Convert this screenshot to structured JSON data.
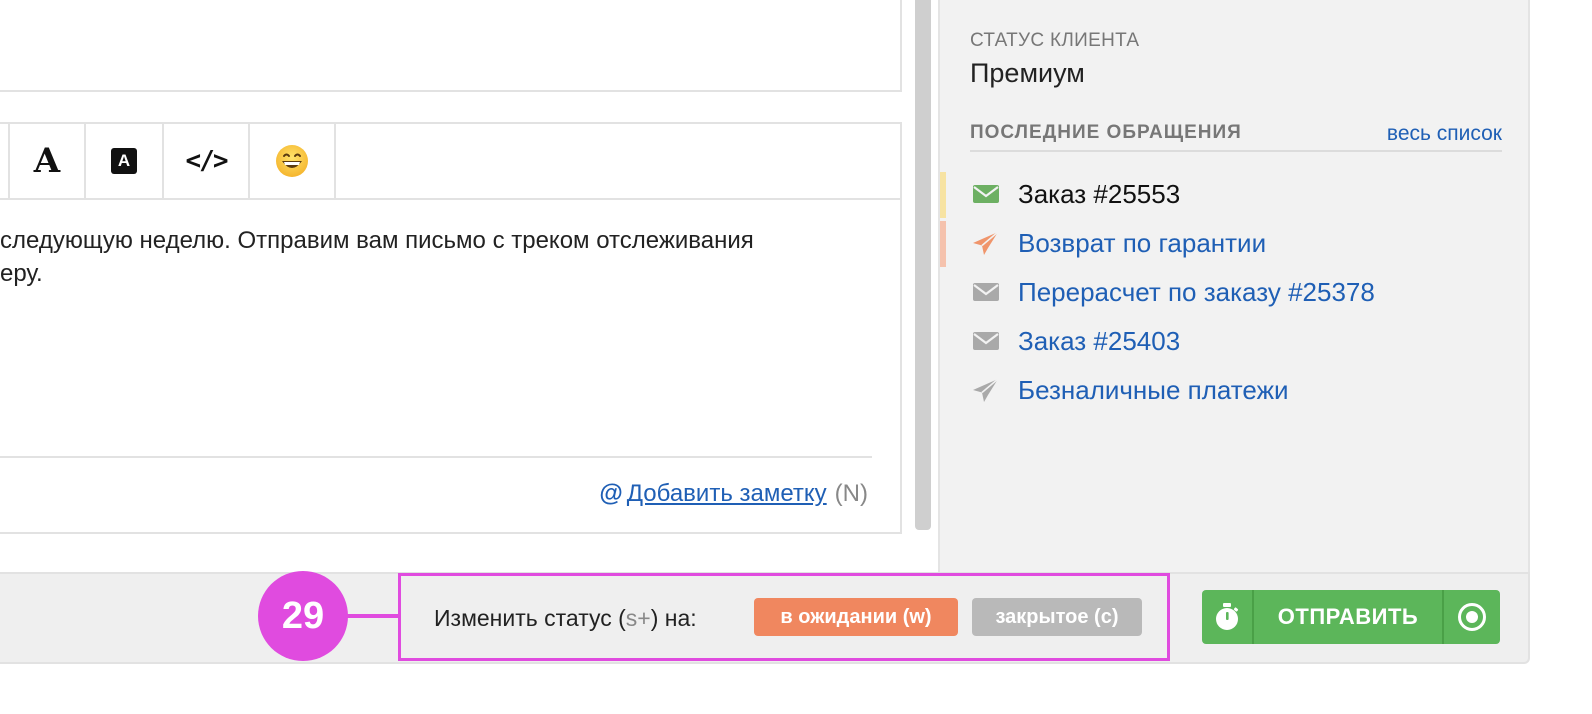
{
  "editor": {
    "toolbar": {
      "font_button_glyph": "A",
      "highlight_button_glyph": "A",
      "code_button_glyph": "</>",
      "emoji_button_glyph": "😄"
    },
    "body_lines": [
      "следующую неделю. Отправим вам письмо с треком отслеживания",
      "еру."
    ],
    "add_note": {
      "at_symbol": "@",
      "link_label": "Добавить заметку",
      "shortcut": "(N)"
    }
  },
  "sidebar": {
    "customer_status_label": "СТАТУС КЛИЕНТА",
    "customer_status_value": "Премиум",
    "recent_requests": {
      "title": "ПОСЛЕДНИЕ ОБРАЩЕНИЯ",
      "all_link": "весь список",
      "items": [
        {
          "label": "Заказ #25553",
          "icon": "envelope-icon",
          "icon_color": "#6db063",
          "marker_color": "#f7e3a2",
          "is_link": false
        },
        {
          "label": "Возврат по гарантии",
          "icon": "paper-plane-icon",
          "icon_color": "#f0956b",
          "marker_color": "#f5c2ad",
          "is_link": true
        },
        {
          "label": "Перерасчет по заказу #25378",
          "icon": "envelope-icon",
          "icon_color": "#a9a9a9",
          "marker_color": "",
          "is_link": true
        },
        {
          "label": "Заказ #25403",
          "icon": "envelope-icon",
          "icon_color": "#a9a9a9",
          "marker_color": "",
          "is_link": true
        },
        {
          "label": "Безналичные платежи",
          "icon": "paper-plane-icon",
          "icon_color": "#a9a9a9",
          "marker_color": "",
          "is_link": true
        }
      ]
    }
  },
  "bottom_bar": {
    "callout_number": "29",
    "status_change": {
      "label_prefix": "Изменить статус (",
      "shortcut_hint": "s+",
      "label_suffix": ") на:",
      "pending_label": "в ожидании (w)",
      "closed_label": "закрытое (c)"
    },
    "send_button_label": "ОТПРАВИТЬ"
  },
  "colors": {
    "accent_link": "#1f5fb5",
    "callout": "#e04bdf",
    "pending_pill": "#f0875f",
    "closed_pill": "#b9b9b9",
    "send_green": "#5cb65a"
  }
}
